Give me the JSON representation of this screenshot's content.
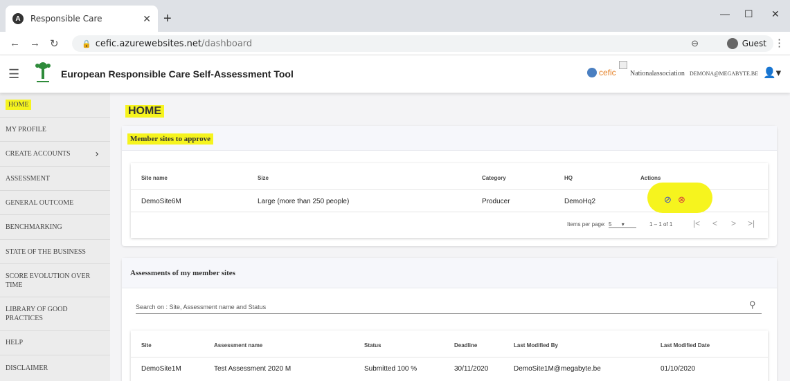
{
  "browser": {
    "tab_title": "Responsible Care",
    "url_host": "cefic.azurewebsites.net",
    "url_path": "/dashboard",
    "guest_label": "Guest"
  },
  "header": {
    "app_title": "European Responsible Care Self-Assessment Tool",
    "partner_logo_text": "cefic",
    "role": "Nationalassociation",
    "user_email": "DEMONA@MEGABYTE.BE"
  },
  "sidebar": {
    "items": [
      {
        "label": "HOME"
      },
      {
        "label": "MY PROFILE"
      },
      {
        "label": "CREATE ACCOUNTS"
      },
      {
        "label": "ASSESSMENT"
      },
      {
        "label": "GENERAL OUTCOME"
      },
      {
        "label": "BENCHMARKING"
      },
      {
        "label": "STATE OF THE BUSINESS"
      },
      {
        "label": "SCORE EVOLUTION OVER TIME"
      },
      {
        "label": "LIBRARY OF GOOD PRACTICES"
      },
      {
        "label": "HELP"
      },
      {
        "label": "DISCLAIMER"
      }
    ]
  },
  "main": {
    "page_title": "HOME",
    "approve": {
      "title": "Member sites to approve",
      "columns": [
        "Site name",
        "Size",
        "Category",
        "HQ",
        "Actions"
      ],
      "rows": [
        {
          "site": "DemoSite6M",
          "size": "Large (more than 250 people)",
          "category": "Producer",
          "hq": "DemoHq2"
        }
      ],
      "items_per_page_label": "Items per page:",
      "items_per_page_value": "5",
      "range": "1 – 1 of 1"
    },
    "assessments": {
      "title": "Assessments of my member sites",
      "search_placeholder": "Search on : Site, Assessment name and Status",
      "columns": [
        "Site",
        "Assessment name",
        "Status",
        "Deadline",
        "Last Modified By",
        "Last Modified Date"
      ],
      "rows": [
        {
          "site": "DemoSite1M",
          "name": "Test Assessment 2020 M",
          "status": "Submitted 100 %",
          "deadline": "30/11/2020",
          "modified_by": "DemoSite1M@megabyte.be",
          "modified_date": "01/10/2020"
        }
      ]
    }
  },
  "colors": {
    "highlight": "#f6f41e",
    "approve_icon": "#3b4ec0",
    "reject_icon": "#d43b3b",
    "cefic_orange": "#e47c1e"
  }
}
